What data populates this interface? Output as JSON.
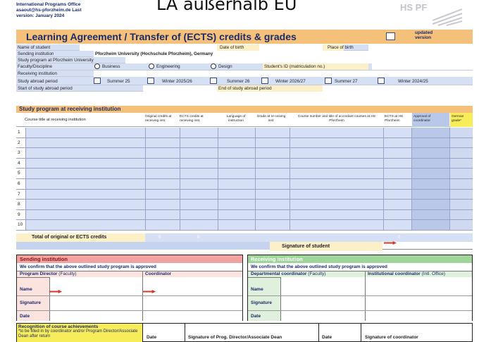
{
  "office": {
    "line1": "International Programs Office",
    "line2": "asaout@hs-pforzheim.de Last",
    "line3": "version: January 2024"
  },
  "overlay_title": "LA außerhalb EU",
  "logo_text": "HS PF",
  "title": "Learning Agreement / Transfer of (ECTS) credits & grades",
  "updated": "updated version",
  "fields": {
    "name": "Name of student",
    "dob": "Date of birth",
    "pob": "Place of birth",
    "sending": "Sending institution",
    "sending_val": "Pforzheim University (Hochschule Pforzheim), Germany",
    "program": "Study program at Pforzheim University",
    "faculty": "Faculty/Discipline",
    "business": "Business",
    "engineering": "Engineering",
    "design": "Design",
    "sid": "Student's ID (matriculation no.)",
    "receiving": "Receiving institution",
    "period": "Study abroad period",
    "s25": "Summer 25",
    "w2526": "Winter 2025/26",
    "s26": "Summer 26",
    "w2627": "Winter 2026/27",
    "s27": "Summer 27",
    "w2425": "Winter 2024/25",
    "start": "Start of study abroad period",
    "end": "End of study abroad period"
  },
  "study": {
    "heading": "Study program at receiving institution",
    "cols": [
      "Course title at receiving institution",
      "Original credits at receiving inst.",
      "ECTS credits at receiving inst.",
      "Language of instruction",
      "Grade at re-ceiving inst.",
      "Course number and title of accordant courses at HS Pforzheim",
      "ECTS at HS Pforzheim",
      "Approval of coordinator",
      "German grade*"
    ],
    "rows": [
      "1",
      "2",
      "3",
      "4",
      "5",
      "6",
      "7",
      "8",
      "9",
      "10"
    ],
    "total": "Total of original or ECTS credits",
    "t1": "0",
    "t2": "0",
    "t3": "0",
    "sig": "Signature of student"
  },
  "sending_box": {
    "title": "Sending institution",
    "confirm": "We confirm that the above outlined study program is approved",
    "director": "Program Director",
    "director_note": "(Faculty)",
    "coordinator": "Coordinator",
    "name": "Name",
    "signature": "Signature",
    "date": "Date"
  },
  "receiving_box": {
    "title": "Receiving institution",
    "confirm": "We confirm that the above outlined study program is approved",
    "dep": "Departmental coordinator",
    "dep_note": "(Faculty)",
    "inst": "Institutional coordinator",
    "inst_note": "(Intl. Office)",
    "name": "Name",
    "signature": "Signature",
    "date": "Date"
  },
  "recog": {
    "title": "Recognition of course achievements",
    "note": "*to be filled in by coordinator and/or Program Director/Associate Dean after return",
    "date1": "Date",
    "sig1": "Signature of Prog. Director/Associate Dean",
    "date2": "Date",
    "sig2": "Signature of coordinator"
  }
}
